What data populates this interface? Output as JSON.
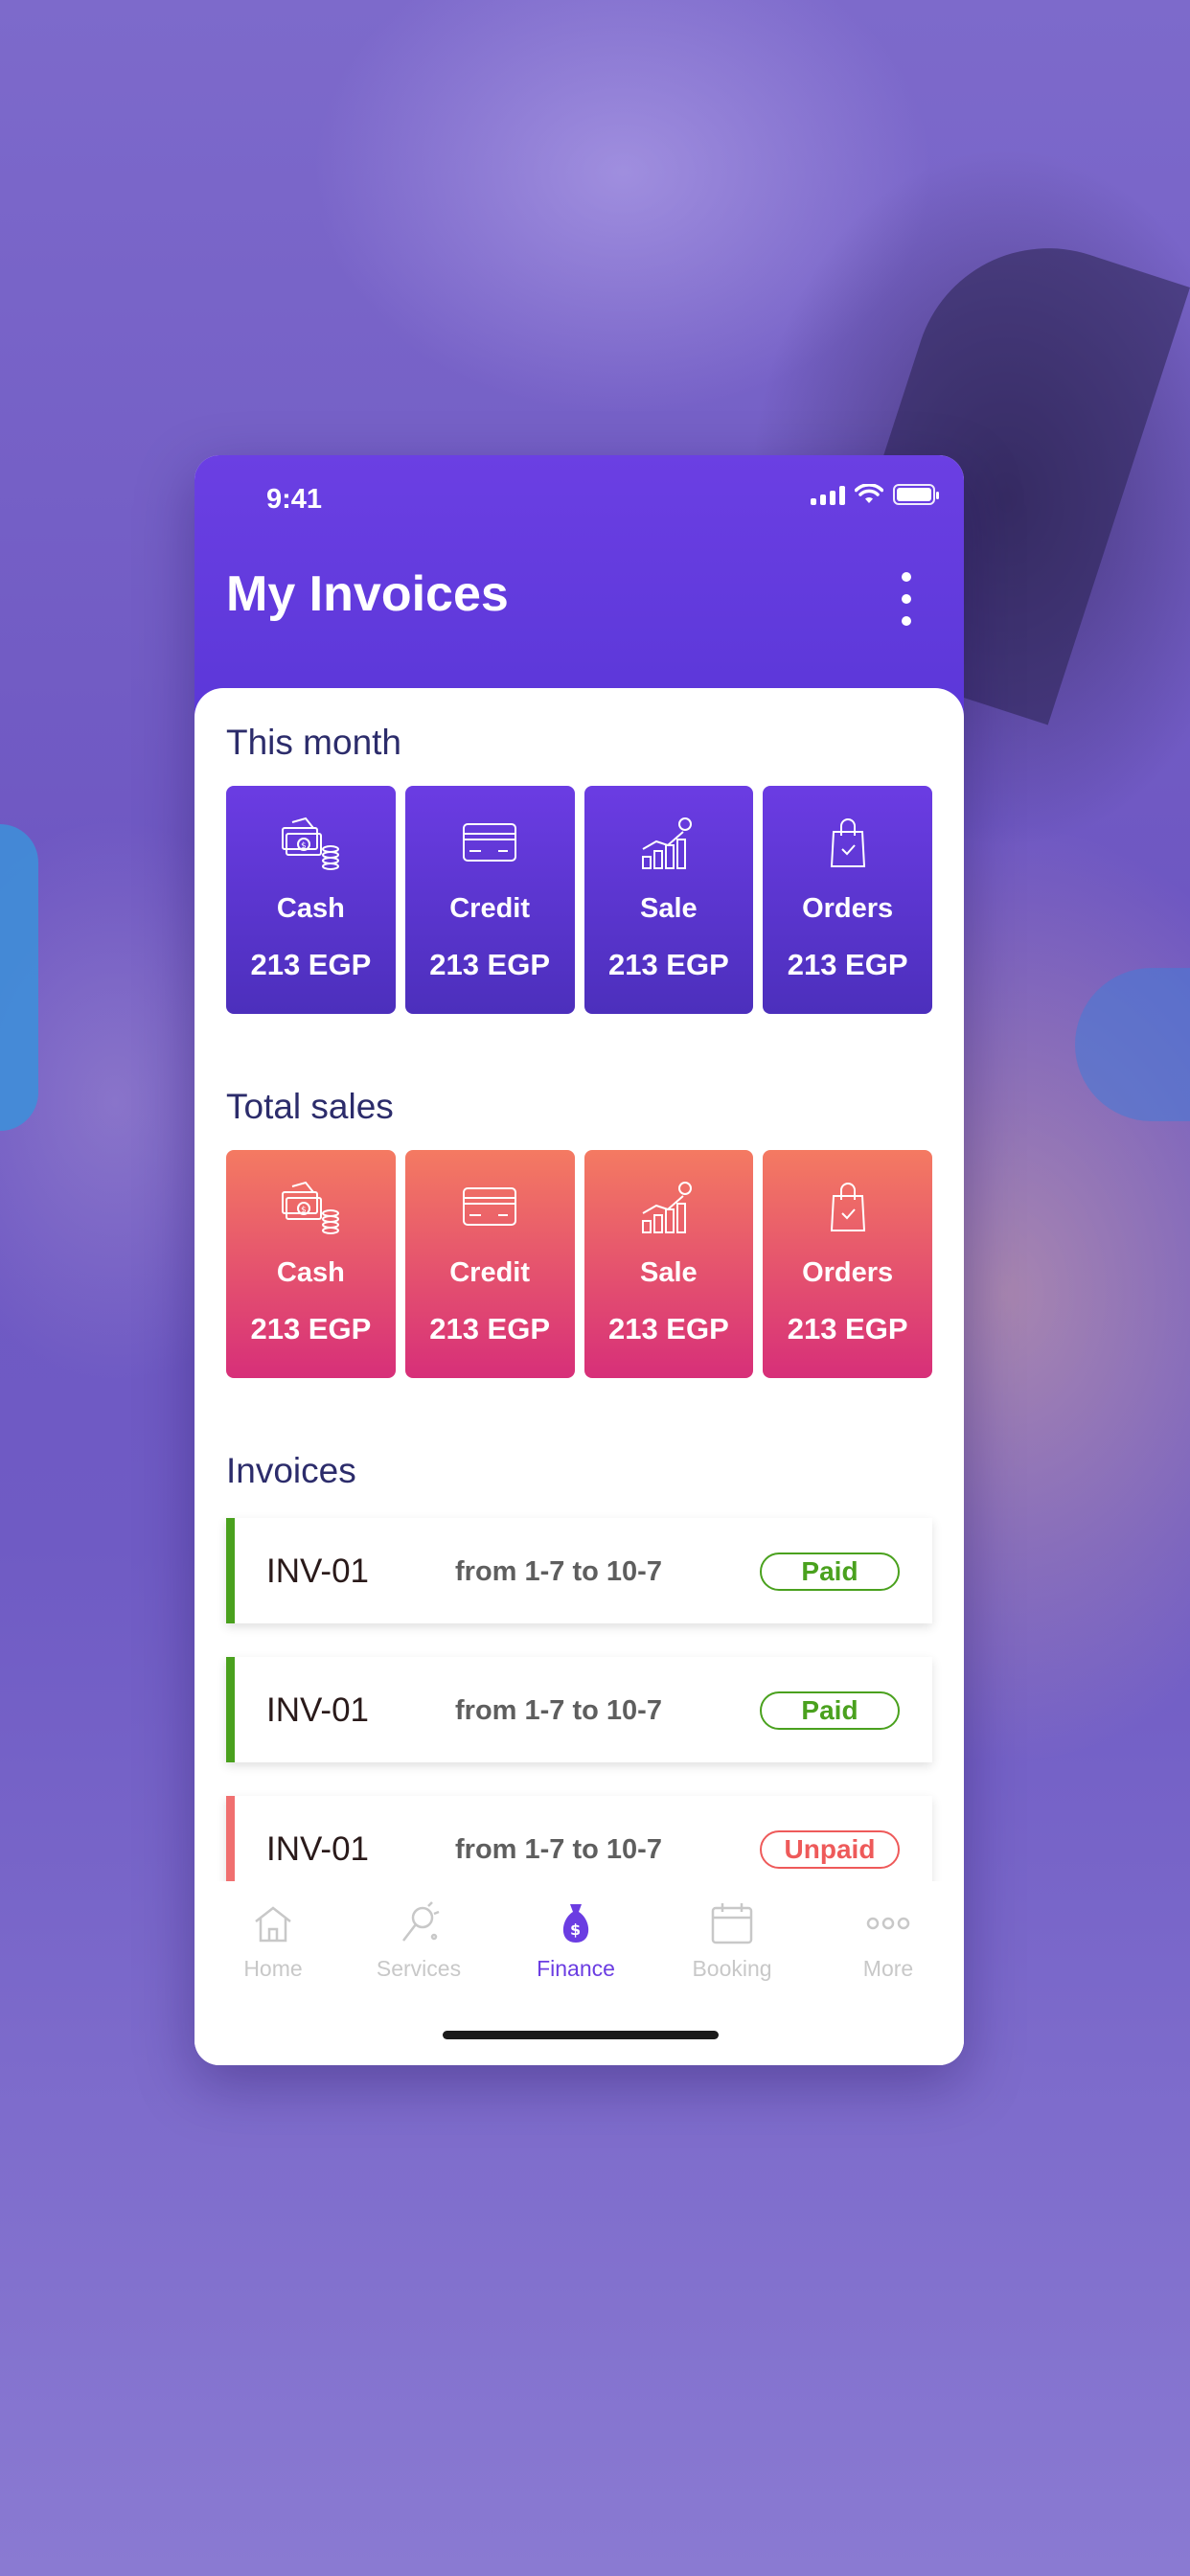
{
  "status_bar": {
    "time": "9:41"
  },
  "header": {
    "title": "My Invoices"
  },
  "this_month": {
    "title": "This month",
    "cards": [
      {
        "label": "Cash",
        "amount": "213 EGP",
        "icon": "cash-icon"
      },
      {
        "label": "Credit",
        "amount": "213 EGP",
        "icon": "credit-card-icon"
      },
      {
        "label": "Sale",
        "amount": "213 EGP",
        "icon": "sales-growth-icon"
      },
      {
        "label": "Orders",
        "amount": "213 EGP",
        "icon": "shopping-bag-icon"
      }
    ]
  },
  "total_sales": {
    "title": "Total sales",
    "cards": [
      {
        "label": "Cash",
        "amount": "213 EGP",
        "icon": "cash-icon"
      },
      {
        "label": "Credit",
        "amount": "213 EGP",
        "icon": "credit-card-icon"
      },
      {
        "label": "Sale",
        "amount": "213 EGP",
        "icon": "sales-growth-icon"
      },
      {
        "label": "Orders",
        "amount": "213 EGP",
        "icon": "shopping-bag-icon"
      }
    ]
  },
  "invoices": {
    "title": "Invoices",
    "items": [
      {
        "id": "INV-01",
        "range": "from 1-7  to 10-7",
        "status": "Paid"
      },
      {
        "id": "INV-01",
        "range": "from 1-7  to 10-7",
        "status": "Paid"
      },
      {
        "id": "INV-01",
        "range": "from 1-7  to 10-7",
        "status": "Unpaid"
      }
    ]
  },
  "tab_bar": {
    "items": [
      {
        "label": "Home",
        "icon": "home-icon"
      },
      {
        "label": "Services",
        "icon": "services-icon"
      },
      {
        "label": "Finance",
        "icon": "money-bag-icon",
        "active": true
      },
      {
        "label": "Booking",
        "icon": "calendar-icon"
      },
      {
        "label": "More",
        "icon": "more-dots-icon"
      }
    ]
  },
  "colors": {
    "header_purple": "#6b3fe3",
    "card_purple": "#5b37d8",
    "card_pink": "#e24a6e",
    "paid_green": "#4aa11e",
    "unpaid_red": "#ee5a5a",
    "active_tab": "#6b3de2"
  }
}
